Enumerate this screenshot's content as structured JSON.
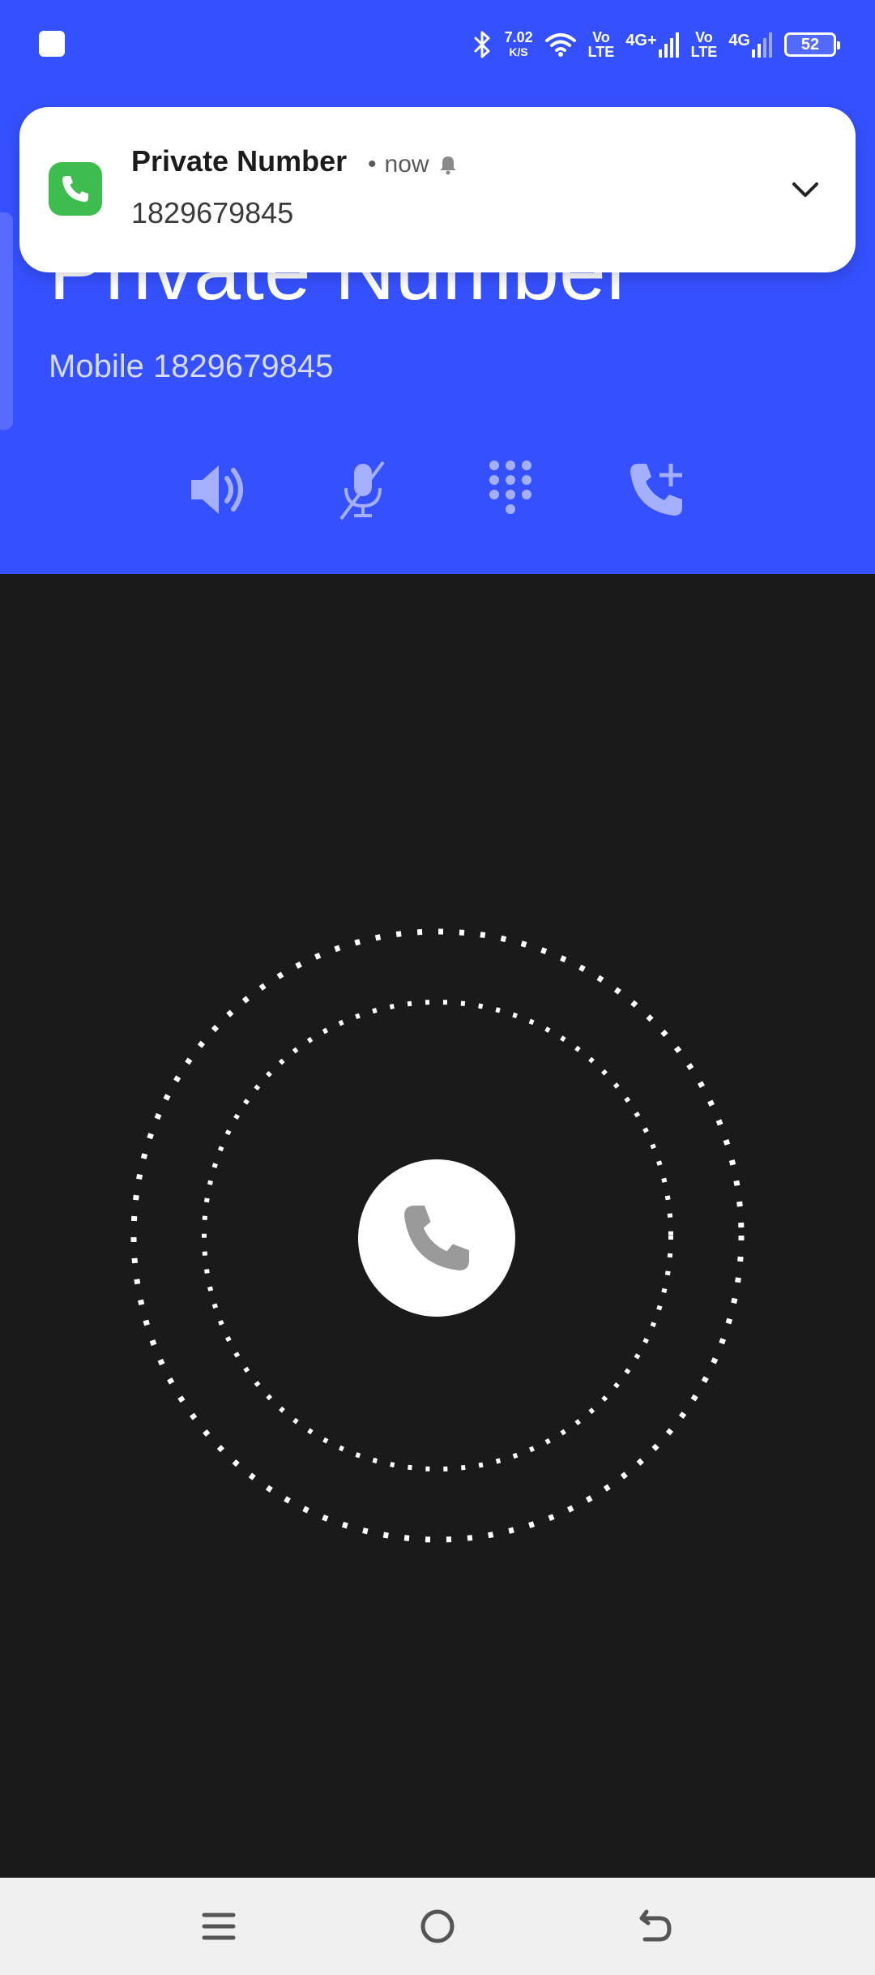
{
  "status_bar": {
    "speed_value": "7.02",
    "speed_unit": "K/S",
    "volte1_top": "Vo",
    "volte1_bottom": "LTE",
    "network1": "4G+",
    "volte2_top": "Vo",
    "volte2_bottom": "LTE",
    "network2": "4G",
    "battery": "52"
  },
  "notification": {
    "title": "Private Number",
    "separator": "•",
    "time": "now",
    "body": "1829679845"
  },
  "caller": {
    "name": "Private Number",
    "subtitle": "Mobile 1829679845"
  },
  "colors": {
    "accent_blue": "#3551ff",
    "call_green": "#3ebd4f",
    "dark_bg": "#1a1a1a"
  },
  "icons": {
    "speaker": "speaker-icon",
    "mute": "mic-off-icon",
    "keypad": "dialpad-icon",
    "add_call": "add-call-icon",
    "answer": "phone-icon",
    "nav_menu": "menu-icon",
    "nav_home": "home-icon",
    "nav_back": "back-icon"
  }
}
